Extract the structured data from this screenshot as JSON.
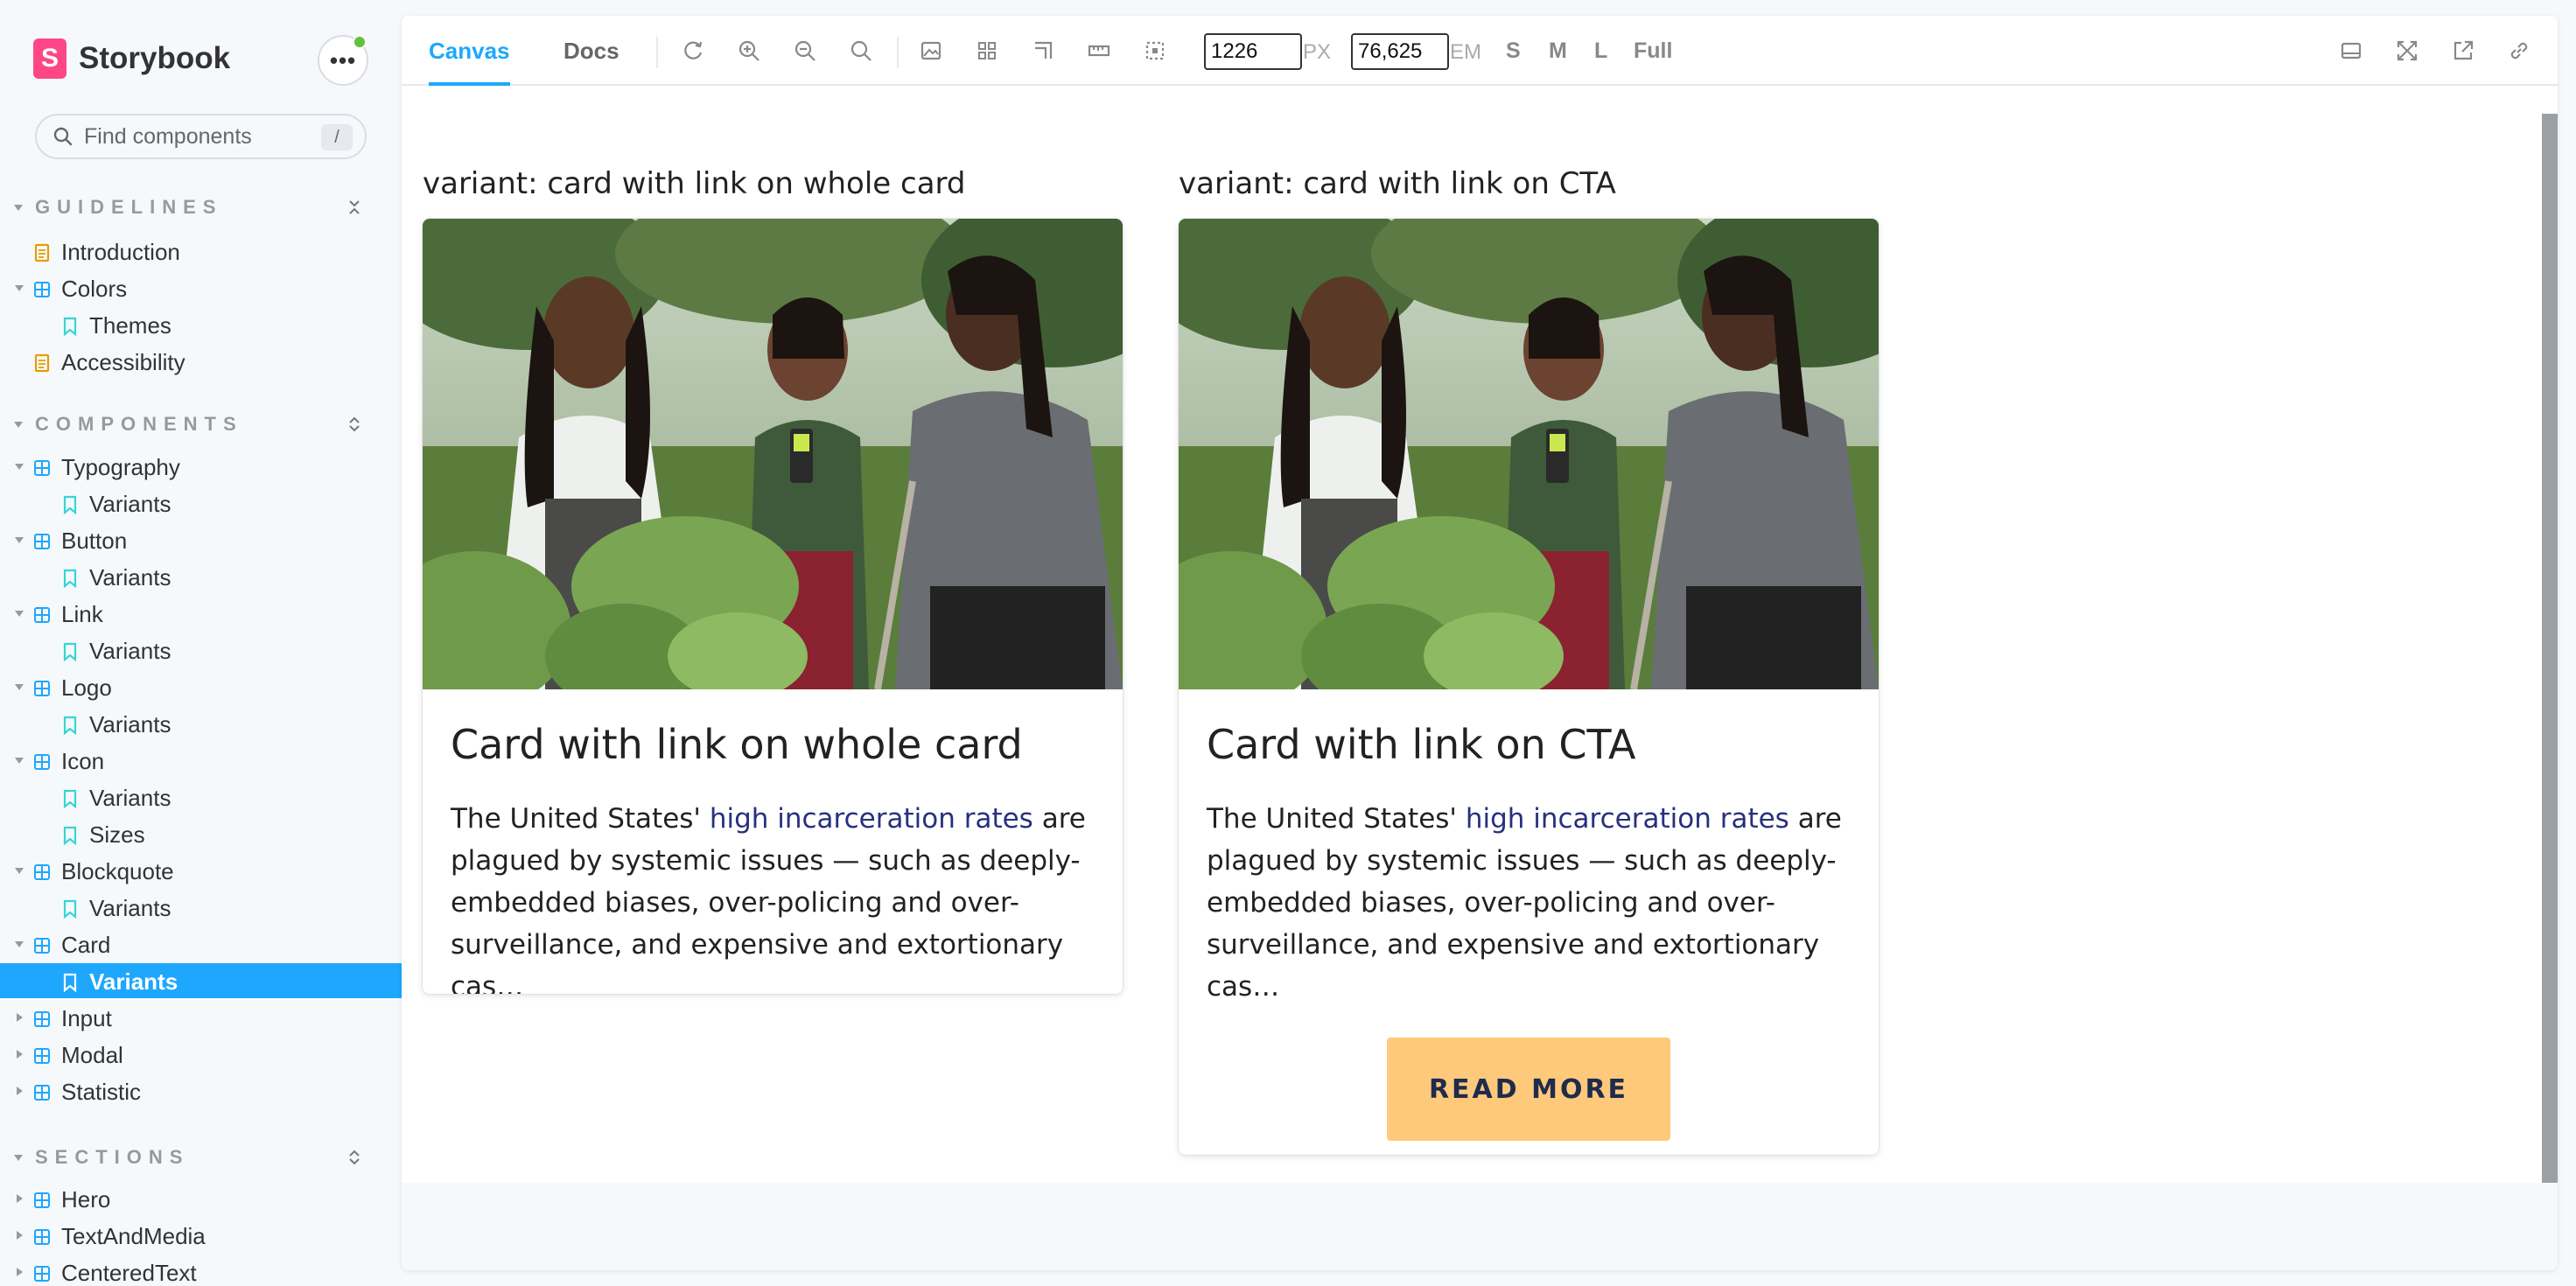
{
  "sidebar": {
    "brand": "Storybook",
    "brand_mark": "S",
    "menu_label": "•••",
    "search": {
      "placeholder": "Find components",
      "shortcut": "/"
    },
    "sections": [
      {
        "title": "GUIDELINES",
        "items": [
          {
            "label": "Introduction",
            "type": "doc"
          },
          {
            "label": "Colors",
            "type": "component",
            "expanded": true
          },
          {
            "label": "Themes",
            "type": "story"
          },
          {
            "label": "Accessibility",
            "type": "doc"
          }
        ]
      },
      {
        "title": "COMPONENTS",
        "items": [
          {
            "label": "Typography",
            "type": "component",
            "expanded": true
          },
          {
            "label": "Variants",
            "type": "story"
          },
          {
            "label": "Button",
            "type": "component",
            "expanded": true
          },
          {
            "label": "Variants",
            "type": "story"
          },
          {
            "label": "Link",
            "type": "component",
            "expanded": true
          },
          {
            "label": "Variants",
            "type": "story"
          },
          {
            "label": "Logo",
            "type": "component",
            "expanded": true
          },
          {
            "label": "Variants",
            "type": "story"
          },
          {
            "label": "Icon",
            "type": "component",
            "expanded": true
          },
          {
            "label": "Variants",
            "type": "story"
          },
          {
            "label": "Sizes",
            "type": "story"
          },
          {
            "label": "Blockquote",
            "type": "component",
            "expanded": true
          },
          {
            "label": "Variants",
            "type": "story"
          },
          {
            "label": "Card",
            "type": "component",
            "expanded": true
          },
          {
            "label": "Variants",
            "type": "story",
            "selected": true
          },
          {
            "label": "Input",
            "type": "component",
            "expanded": false
          },
          {
            "label": "Modal",
            "type": "component",
            "expanded": false
          },
          {
            "label": "Statistic",
            "type": "component",
            "expanded": false
          }
        ]
      },
      {
        "title": "SECTIONS",
        "items": [
          {
            "label": "Hero",
            "type": "component",
            "expanded": false
          },
          {
            "label": "TextAndMedia",
            "type": "component",
            "expanded": false
          },
          {
            "label": "CenteredText",
            "type": "component",
            "expanded": false
          }
        ]
      }
    ]
  },
  "toolbar": {
    "tabs": [
      "Canvas",
      "Docs"
    ],
    "active_tab": "Canvas",
    "width_value": "1226",
    "width_unit": "PX",
    "em_value": "76,625",
    "em_unit": "EM",
    "viewports": [
      "S",
      "M",
      "L",
      "Full"
    ]
  },
  "canvas": {
    "variant_1_label": "variant: card with link on whole card",
    "variant_2_label": "variant: card with link on CTA",
    "card_1": {
      "title": "Card with link on whole card",
      "body_before": "The United States' ",
      "body_link": "high incarceration rates",
      "body_after": " are plagued by systemic issues — such as deeply-embedded biases, over-policing and over-surveillance, and expensive and extortionary cas…"
    },
    "card_2": {
      "title": "Card with link on CTA",
      "body_before": "The United States' ",
      "body_link": "high incarceration rates",
      "body_after": " are plagued by systemic issues — such as deeply-embedded biases, over-policing and over-surveillance, and expensive and extortionary cas…",
      "cta": "READ MORE"
    }
  },
  "colors": {
    "accent": "#1ea7fd",
    "brand": "#ff4785",
    "status_dot": "#66bf3c",
    "cta_bg": "#fec97a",
    "link_text": "#28307e"
  }
}
